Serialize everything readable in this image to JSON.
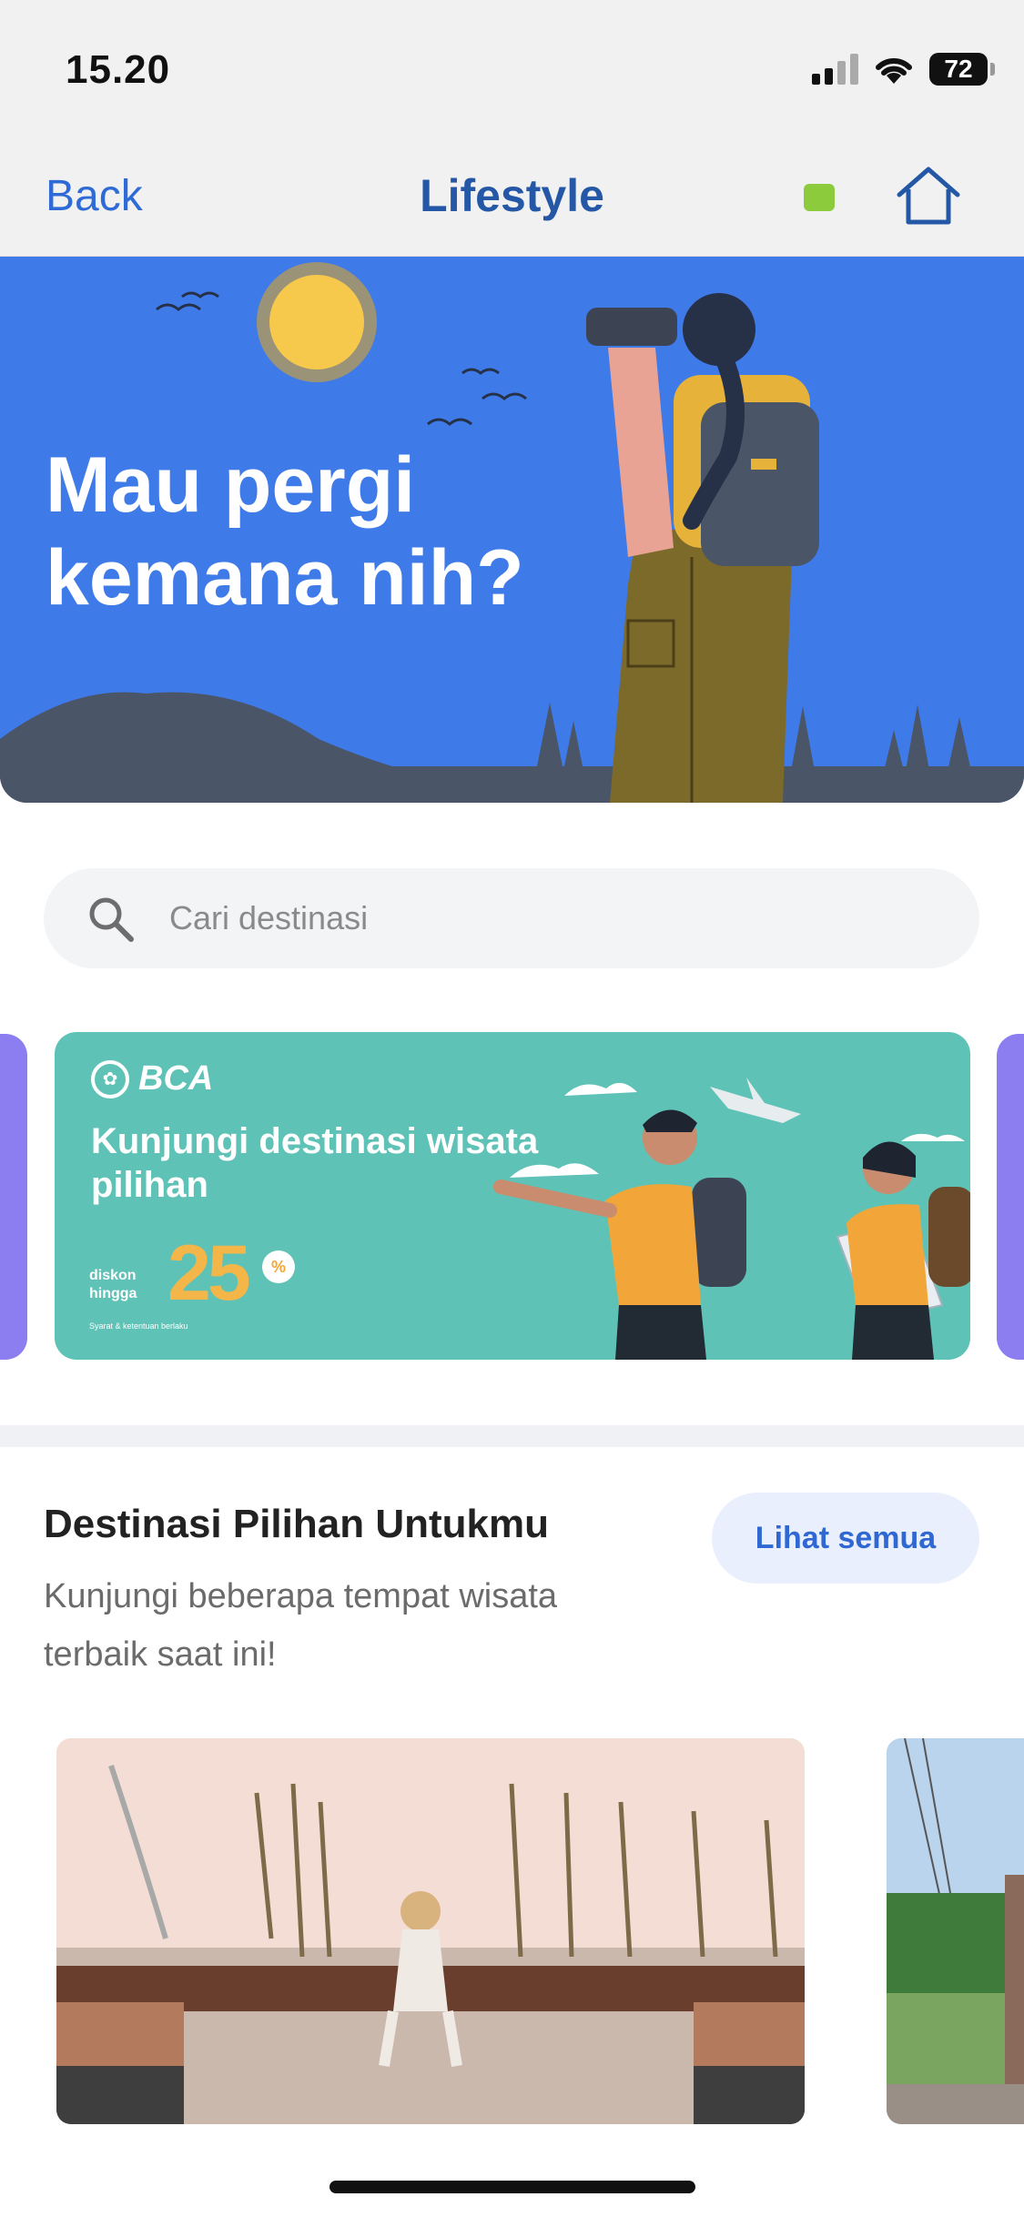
{
  "status_bar": {
    "time": "15.20",
    "battery": "72"
  },
  "nav": {
    "back_label": "Back",
    "title": "Lifestyle"
  },
  "hero": {
    "title": "Mau pergi kemana nih?"
  },
  "search": {
    "placeholder": "Cari destinasi"
  },
  "banner": {
    "brand": "BCA",
    "title": "Kunjungi destinasi wisata pilihan",
    "discount_label": "diskon hingga",
    "discount_value": "25",
    "discount_unit": "%",
    "terms": "Syarat & ketentuan berlaku"
  },
  "section": {
    "title": "Destinasi Pilihan Untukmu",
    "subtitle": "Kunjungi beberapa tempat wisata terbaik saat ini!",
    "see_all_label": "Lihat semua"
  },
  "colors": {
    "accent": "#2f6bd6",
    "hero_bg": "#3f7ae9",
    "banner_bg": "#5fc2b6"
  }
}
